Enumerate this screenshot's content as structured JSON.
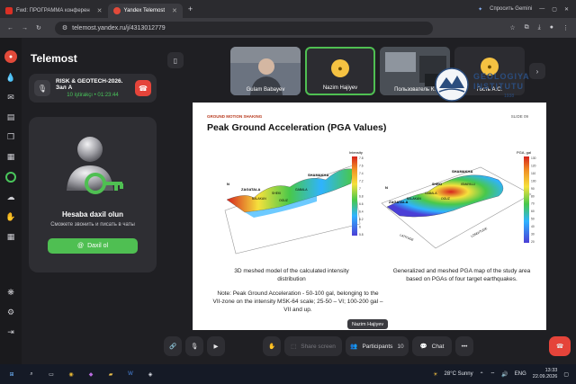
{
  "browser": {
    "tabs": [
      {
        "label": "Fwd: ПРОГРАММА конферен"
      },
      {
        "label": "Yandex Telemost"
      }
    ],
    "new_tab": "+",
    "ask_gemini": "Спросить Gemini",
    "url": "telemost.yandex.ru/j/4313012779"
  },
  "sidebar": {
    "app_title": "Telemost",
    "meeting": {
      "title": "RISK & GEOTECH-2026. Зал А",
      "subtitle": "10 iştirakçı • 01:23:44"
    },
    "login": {
      "title": "Hesaba daxil olun",
      "subtitle": "Сможете звонить и писать в чаты",
      "button": "Daxil ol"
    }
  },
  "participants": [
    {
      "name": "Gulam Babayev"
    },
    {
      "name": "Nazim Hajiyev"
    },
    {
      "name": "Пользователь К."
    },
    {
      "name": "Гость А.С."
    }
  ],
  "watermark": {
    "line1": "GEOLOGIYA",
    "line2": "INSTITUTU",
    "year": "1938"
  },
  "slide": {
    "section": "GROUND MOTION SHAKING",
    "slide_no": "SLIDE 09",
    "title": "Peak Ground Acceleration (PGA Values)",
    "left_map": {
      "colorbar_title": "Intensity",
      "colorbar_ticks": [
        "7.8",
        "7.6",
        "7.4",
        "7.2",
        "7",
        "6.8",
        "6.6",
        "6.4",
        "6.2",
        "6",
        "5.8"
      ],
      "labels": [
        "ZAGATALA",
        "SHAMAKHA",
        "BALAKAN",
        "SHEKI",
        "OGUZ",
        "GABALA",
        "N"
      ]
    },
    "right_map": {
      "colorbar_title": "PGA, gal",
      "colorbar_ticks": [
        "130",
        "120",
        "110",
        "100",
        "90",
        "80",
        "70",
        "60",
        "50",
        "40",
        "30",
        "20"
      ],
      "labels": [
        "SHAMAKHA",
        "SHEKI",
        "GABALA",
        "ZAGATALA",
        "ISMAYILLI",
        "OGUZ",
        "BALAKAN",
        "N"
      ],
      "axis_labels": [
        "LONGITUDE",
        "LATITUDE"
      ]
    },
    "caption_left": "3D meshed model of the calculated intensity distribution",
    "caption_right": "Generalized and meshed PGA map of the study area based on PGAs of four target earthquakes.",
    "note": "Note: Peak Ground Acceleration - 50-100 gal, belonging to the VII-zone on the intensity MSK-64 scale; 25-50 – VI; 100-200 gal – VII and up."
  },
  "speaker": "Nazim Hajiyev",
  "toolbar": {
    "share": "Share screen",
    "participants": "Participants",
    "participants_count": "10",
    "chat": "Chat",
    "more": "•••"
  },
  "taskbar": {
    "weather": "28°C  Sunny",
    "lang": "ENG",
    "time": "13:33",
    "date": "22.09.2026"
  },
  "colors": {
    "accent_green": "#4fbf52",
    "end_red": "#e5443a",
    "speaker_yellow": "#f5c242"
  }
}
